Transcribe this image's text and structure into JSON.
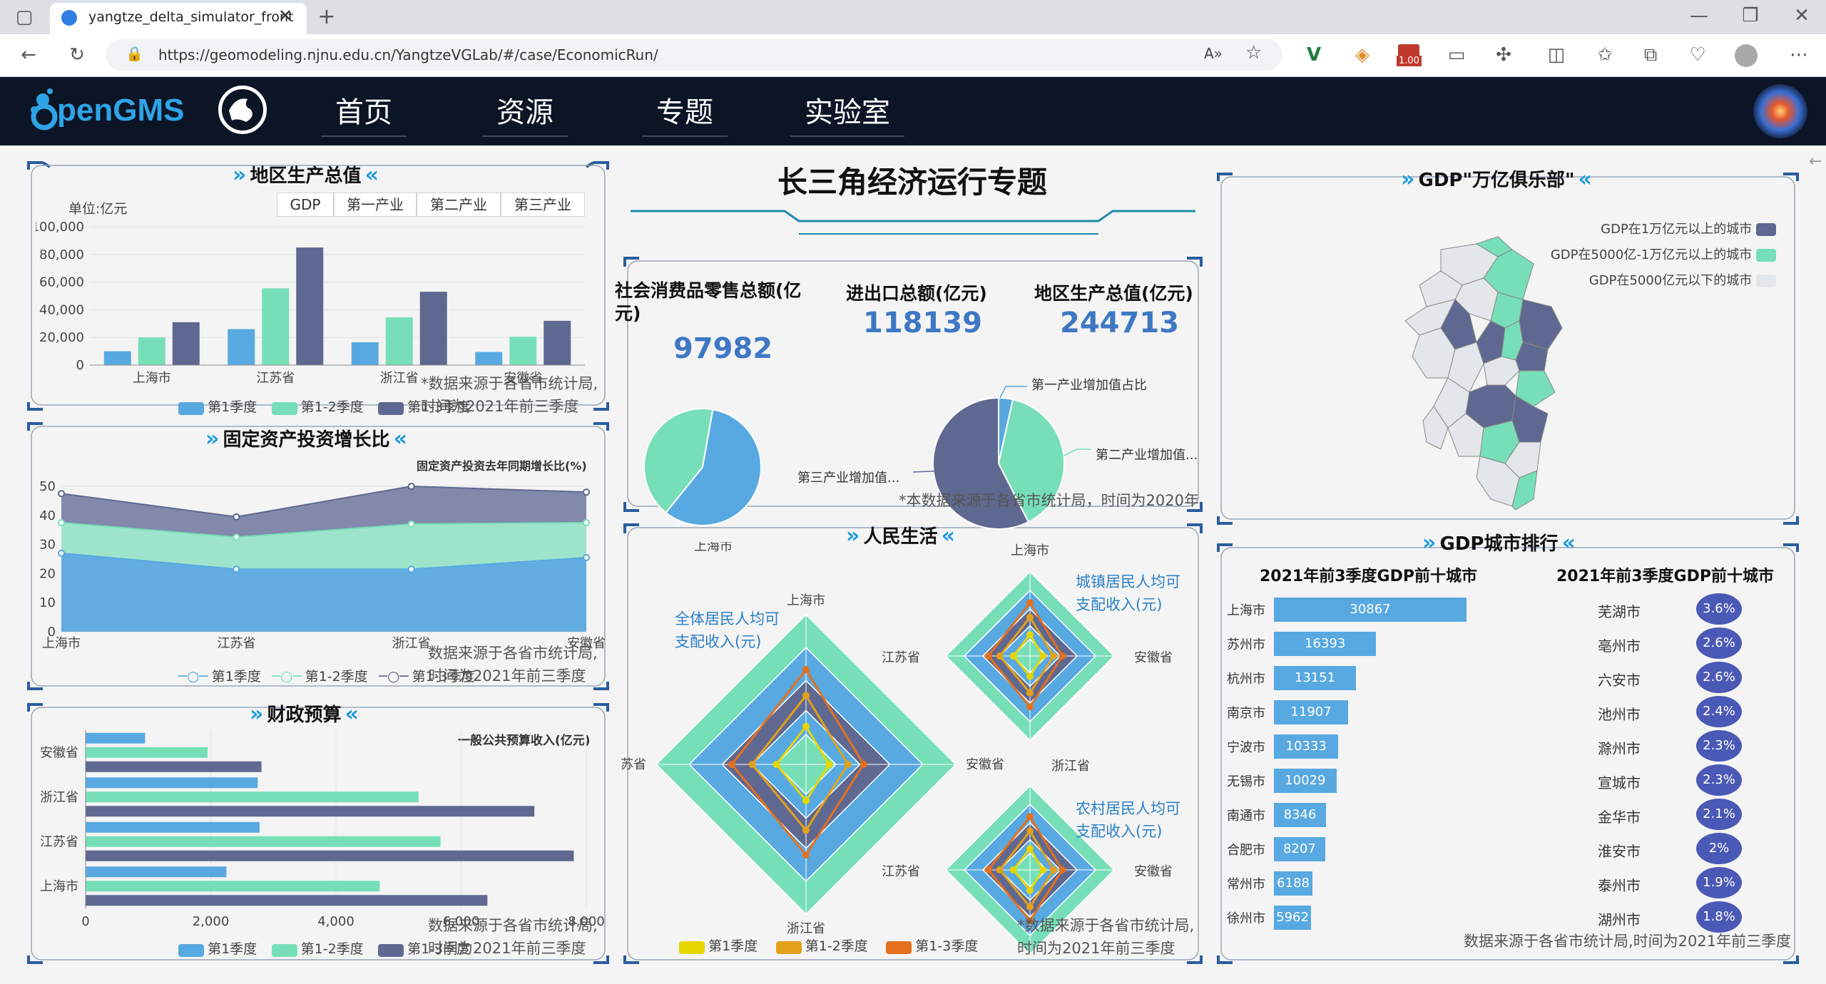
{
  "browser": {
    "tab_title": "yangtze_delta_simulator_front",
    "url": "https://geomodeling.njnu.edu.cn/YangtzeVGLab/#/case/EconomicRun/",
    "badge": "1.00"
  },
  "nav": {
    "logo": "OpenGMS",
    "items": [
      "首页",
      "资源",
      "专题",
      "实验室"
    ]
  },
  "page_title": "长三角经济运行专题",
  "gdp_panel": {
    "title": "地区生产总值",
    "unit": "单位:亿元",
    "tabs": [
      "GDP",
      "第一产业",
      "第二产业",
      "第三产业"
    ],
    "note_line1": "*数据来源于各省市统计局,",
    "note_line2": "时间为2021年前三季度"
  },
  "invest_panel": {
    "title": "固定资产投资增长比",
    "subtitle": "固定资产投资去年同期增长比(%)",
    "note_line1": "数据来源于各省市统计局,",
    "note_line2": "时间为2021年前三季度"
  },
  "budget_panel": {
    "title": "财政预算",
    "subtitle": "一般公共预算收入(亿元)",
    "note_line1": "数据来源于各省市统计局,",
    "note_line2": "时间为2021年前三季度"
  },
  "kpis": [
    {
      "label": "社会消费品零售总额(亿元)",
      "value": "97982"
    },
    {
      "label": "进出口总额(亿元)",
      "value": "118139"
    },
    {
      "label": "地区生产总值(亿元)",
      "value": "244713"
    }
  ],
  "pie_labels": {
    "primary": "第一产业增加值占比",
    "secondary": "第二产业增加值...",
    "tertiary": "第三产业增加值..."
  },
  "pie_note": "*本数据来源于各省市统计局，时间为2020年",
  "life_panel": {
    "title": "人民生活",
    "radar_all": "全体居民人均可\n支配收入(元)",
    "radar_all_l1": "全体居民人均可",
    "radar_all_l2": "支配收入(元)",
    "radar_urban_l1": "城镇居民人均可",
    "radar_urban_l2": "支配收入(元)",
    "radar_rural_l1": "农村居民人均可",
    "radar_rural_l2": "支配收入(元)",
    "axes": [
      "上海市",
      "江苏省",
      "浙江省",
      "安徽省"
    ],
    "axis_clipped": [
      "苏省",
      "浙江省"
    ],
    "legend": [
      "第1季度",
      "第1-2季度",
      "第1-3季度"
    ],
    "note_line1": "*数据来源于各省市统计局,",
    "note_line2": "时间为2021年前三季度"
  },
  "club_panel": {
    "title": "GDP\"万亿俱乐部\"",
    "legend": [
      "GDP在1万亿元以上的城市",
      "GDP在5000亿-1万亿元以上的城市",
      "GDP在5000亿元以下的城市"
    ]
  },
  "rank_panel": {
    "title": "GDP城市排行",
    "left_title": "2021年前3季度GDP前十城市",
    "right_title": "2021年前3季度GDP前十城市",
    "note": "数据来源于各省市统计局,时间为2021年前三季度",
    "cities": [
      "上海市",
      "苏州市",
      "杭州市",
      "南京市",
      "宁波市",
      "无锡市",
      "南通市",
      "合肥市",
      "常州市",
      "徐州市"
    ],
    "gdp": [
      30867,
      16393,
      13151,
      11907,
      10333,
      10029,
      8346,
      8207,
      6188,
      5962
    ],
    "growth_cities": [
      "芜湖市",
      "亳州市",
      "六安市",
      "池州市",
      "滁州市",
      "宣城市",
      "金华市",
      "淮安市",
      "泰州市",
      "湖州市"
    ],
    "growth": [
      "3.6%",
      "2.6%",
      "2.6%",
      "2.4%",
      "2.3%",
      "2.3%",
      "2.1%",
      "2%",
      "1.9%",
      "1.8%"
    ]
  },
  "chart_data": [
    {
      "type": "bar",
      "title": "地区生产总值",
      "ylabel": "单位:亿元",
      "categories": [
        "上海市",
        "江苏省",
        "浙江省",
        "安徽省"
      ],
      "ylim": [
        0,
        100000
      ],
      "yticks": [
        "0",
        "20,000",
        "40,000",
        "60,000",
        "80,000",
        "100,000"
      ],
      "series": [
        {
          "name": "第1季度",
          "values": [
            10000,
            26000,
            16500,
            9500
          ]
        },
        {
          "name": "第1-2季度",
          "values": [
            20000,
            55500,
            34500,
            20500
          ]
        },
        {
          "name": "第1-3季度",
          "values": [
            31000,
            85000,
            53000,
            32000
          ]
        }
      ]
    },
    {
      "type": "area",
      "title": "固定资产投资增长比",
      "ylabel": "固定资产投资去年同期增长比(%)",
      "categories": [
        "上海市",
        "江苏省",
        "浙江省",
        "安徽省"
      ],
      "ylim": [
        0,
        50
      ],
      "yticks": [
        "0",
        "10",
        "20",
        "30",
        "40",
        "50"
      ],
      "series": [
        {
          "name": "第1季度",
          "values": [
            27,
            21.5,
            21.5,
            25.5
          ]
        },
        {
          "name": "第1-2季度",
          "values": [
            37.5,
            32.5,
            37,
            37.5
          ]
        },
        {
          "name": "第1-3季度",
          "values": [
            47.5,
            39.5,
            50,
            48
          ]
        }
      ]
    },
    {
      "type": "bar",
      "title": "财政预算",
      "xlabel": "一般公共预算收入(亿元)",
      "categories": [
        "上海市",
        "江苏省",
        "浙江省",
        "安徽省"
      ],
      "xlim": [
        0,
        8000
      ],
      "xticks": [
        "0",
        "2,000",
        "4,000",
        "6,000",
        "8,000"
      ],
      "series": [
        {
          "name": "第1季度",
          "values": [
            2250,
            2780,
            2750,
            950
          ]
        },
        {
          "name": "第1-2季度",
          "values": [
            4700,
            5670,
            5320,
            1950
          ]
        },
        {
          "name": "第1-3季度",
          "values": [
            6420,
            7800,
            7170,
            2810
          ]
        }
      ]
    },
    {
      "type": "pie",
      "labels": [
        "第一产业增加值占比",
        "第二产业增加值...",
        "第三产业增加值..."
      ],
      "values": [
        3.5,
        39,
        57.5
      ]
    },
    {
      "type": "pie",
      "values": [
        58,
        42
      ]
    }
  ]
}
